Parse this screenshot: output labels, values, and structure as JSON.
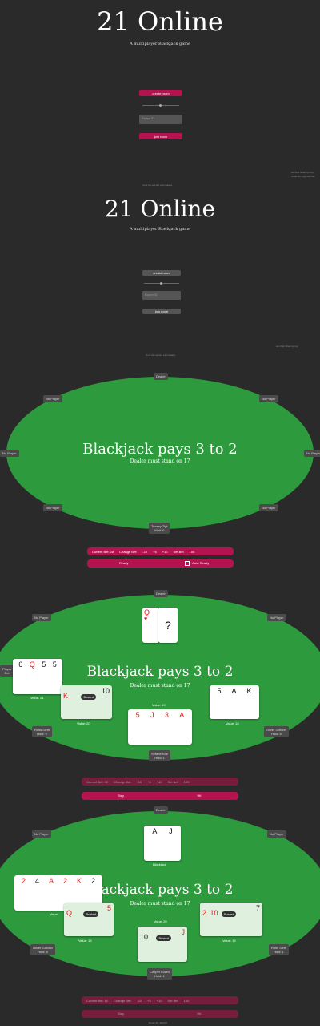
{
  "app": {
    "title": "21 Online",
    "subtitle": "A multiplayer Blackjack game"
  },
  "lobby": {
    "create_label": "create room",
    "room_placeholder": "Room ID",
    "join_label": "join room",
    "side_note_1": "ws://api.4ctap.tp.nop",
    "side_note_2": "4ctap.tp.rvs@nap.com",
    "room_caption": "Cont the accord cost ttaiaes"
  },
  "table": {
    "headline": "Blackjack pays 3 to 2",
    "rule": "Dealer must stand on 17",
    "dealer_label": "Dealer",
    "no_player": "No Player"
  },
  "panel_1": {
    "player_name": "Tommy Tipt",
    "player_bet": "Wait: 0",
    "bet_bar": [
      "Current Bet: 28",
      "Change Bet:",
      "-10",
      "+5",
      "+10",
      "Set Bet",
      "100"
    ],
    "ready_label": "Ready",
    "auto_ready_label": "Auto Ready"
  },
  "panel_2": {
    "dealer_card_rank": "Q",
    "hidden_card": "?",
    "left_seat_label": "Player",
    "left_seat_value": "Bet",
    "left_hand": [
      "6",
      "Q",
      "5",
      "5"
    ],
    "left_value": "Value: 21",
    "busted_hand": [
      "K",
      "10"
    ],
    "busted_label": "Busted",
    "busted_value": "Value: 20",
    "center_hand": [
      "5",
      "J",
      "3",
      "A"
    ],
    "center_value": "Value: 19",
    "right_hand": [
      "5",
      "A",
      "K"
    ],
    "right_value": "Value: 16",
    "left_bottom_name": "Ross Swift",
    "left_bottom_bet": "Hold: 9",
    "right_bottom_name": "Oliver Gordon",
    "right_bottom_bet": "Hold: 5",
    "self_name": "Sefane Roe",
    "self_bet": "Hold: 1",
    "bet_bar": [
      "Current Bet: 30",
      "Change Bet:",
      "-10",
      "+5",
      "+10",
      "Set Bet",
      "120"
    ],
    "stay_label": "Stay",
    "hit_label": "Hit"
  },
  "panel_3": {
    "dealer_hand": [
      "A",
      "J"
    ],
    "dealer_value": "Blackjack",
    "left_hand": [
      "2",
      "4",
      "A",
      "2",
      "K",
      "2"
    ],
    "left_value": "Value",
    "left_busted_hand": [
      "Q",
      "5"
    ],
    "left_busted_label": "Busted",
    "left_busted_value": "Value: 15",
    "center_hand": [
      "10",
      "J"
    ],
    "center_label": "Busted",
    "center_value": "Value: 20",
    "right_hand": [
      "2",
      "10",
      "7"
    ],
    "right_label": "Busted",
    "right_value": "Value: 19",
    "left_bottom_name": "Oliver Gordon",
    "left_bottom_bet": "Hold: 8",
    "right_bottom_name": "Ross Swift",
    "right_bottom_bet": "Hold: 1",
    "self_name": "Cooper Lovell",
    "self_bet": "Hold: 1",
    "bet_bar": [
      "Current Bet: 10",
      "Change Bet:",
      "-10",
      "+5",
      "+10",
      "Set Bet",
      "100"
    ],
    "stay_label": "Stay",
    "hit_label": "Hit",
    "footer": "Room ID: 4DRT0"
  }
}
